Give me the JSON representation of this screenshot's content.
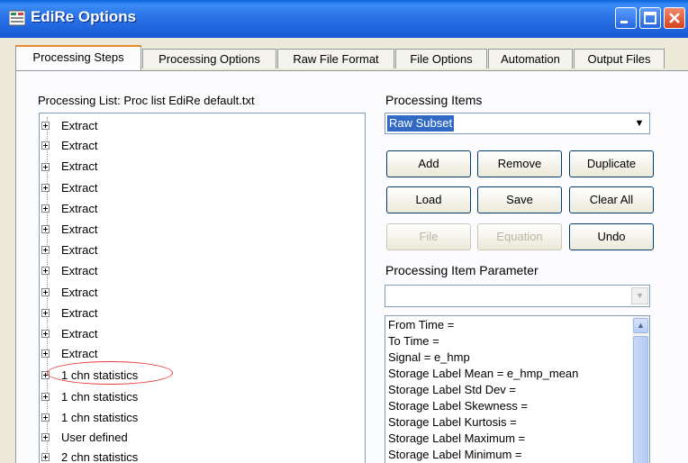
{
  "window": {
    "title": "EdiRe Options"
  },
  "tabs": [
    "Processing Steps",
    "Processing Options",
    "Raw File Format",
    "File Options",
    "Automation",
    "Output Files"
  ],
  "processing_list": {
    "label": "Processing List: Proc list EdiRe default.txt",
    "items": [
      "Extract",
      "Extract",
      "Extract",
      "Extract",
      "Extract",
      "Extract",
      "Extract",
      "Extract",
      "Extract",
      "Extract",
      "Extract",
      "Extract",
      "1 chn statistics",
      "1 chn statistics",
      "1 chn statistics",
      "User defined",
      "2 chn statistics"
    ]
  },
  "processing_items": {
    "label": "Processing Items",
    "selected": "Raw Subset",
    "buttons": {
      "add": "Add",
      "remove": "Remove",
      "duplicate": "Duplicate",
      "load": "Load",
      "save": "Save",
      "clear_all": "Clear All",
      "file": "File",
      "equation": "Equation",
      "undo": "Undo"
    }
  },
  "parameter": {
    "label": "Processing Item Parameter",
    "value": "",
    "lines": [
      "From Time =",
      "To Time =",
      "Signal = e_hmp",
      "Storage Label Mean = e_hmp_mean",
      "Storage Label Std Dev =",
      "Storage Label Skewness =",
      "Storage Label Kurtosis =",
      "Storage Label Maximum =",
      "Storage Label Minimum ="
    ]
  }
}
